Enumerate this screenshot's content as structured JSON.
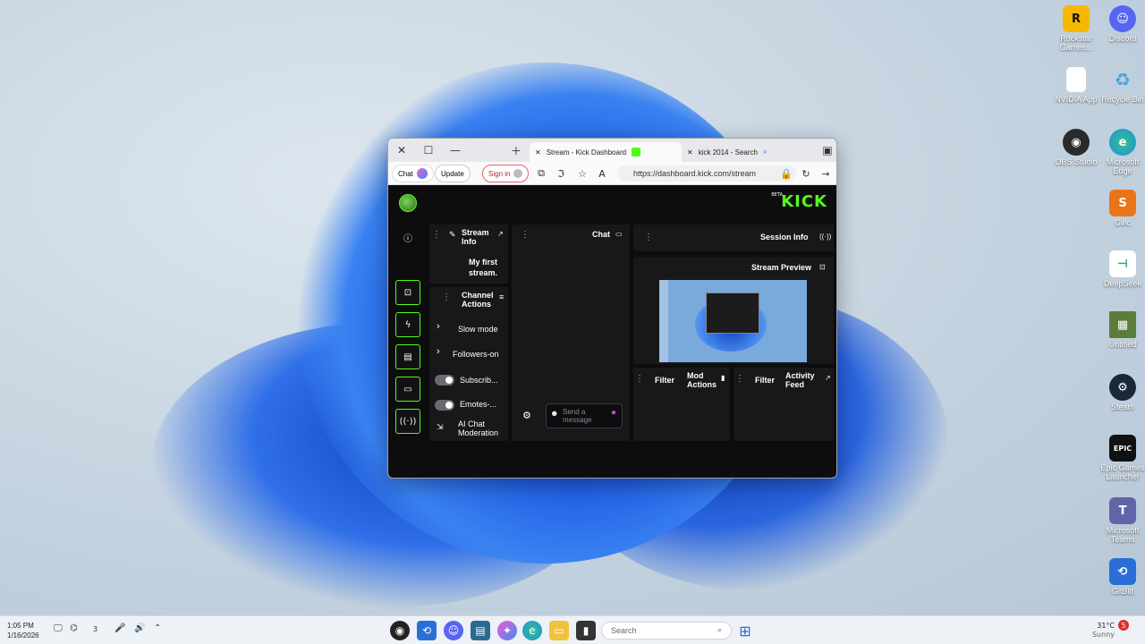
{
  "desktop": {
    "icons_right": [
      {
        "label": "Discord",
        "icon": "discord-icon",
        "color": "#5865f2"
      },
      {
        "label": "Rockstar Games...",
        "icon": "rockstar-icon",
        "color": "#f5b700"
      },
      {
        "label": "Recycle Bin",
        "icon": "recycle-bin-icon",
        "color": "#4aa3df"
      },
      {
        "label": "NVIDIA App",
        "icon": "file-icon",
        "color": "#ffffff"
      },
      {
        "label": "Microsoft Edge",
        "icon": "edge-icon",
        "color": "#1f8fd8"
      },
      {
        "label": "OBS Studio",
        "icon": "obs-icon",
        "color": "#2b2b2b"
      },
      {
        "label": "Gvlc",
        "icon": "app-icon",
        "color": "#e8751a"
      },
      {
        "label": "DeepSeek",
        "icon": "deepseek-icon",
        "color": "#ffffff"
      },
      {
        "label": "Untitled",
        "icon": "minecraft-icon",
        "color": "#5b7d3a"
      },
      {
        "label": "Steam",
        "icon": "steam-icon",
        "color": "#1b2838"
      },
      {
        "label": "Epic Games Launcher",
        "icon": "epic-games-icon",
        "color": "#111111"
      },
      {
        "label": "Microsoft Teams",
        "icon": "teams-icon",
        "color": "#6264a7"
      },
      {
        "label": "GitBlit",
        "icon": "gitblit-icon",
        "color": "#2a6fd6"
      }
    ]
  },
  "browser": {
    "tabs": [
      {
        "label": "Stream - Kick Dashboard",
        "icon": "kick-icon"
      },
      {
        "label": "kick 2014 - Search",
        "icon": "search-icon"
      }
    ],
    "url": "https://dashboard.kick.com/stream",
    "sign_in_label": "Sign in",
    "update_label": "Update",
    "chat_label": "Chat"
  },
  "kick": {
    "logo": "KICK",
    "beta": "BETA",
    "panels": {
      "session_info": "Session Info",
      "stream_preview": "Stream Preview",
      "chat": "Chat",
      "stream_info": "Stream Info",
      "stream_title": "My first stream.",
      "channel_actions": "Channel Actions",
      "activity_feed": "Activity Feed",
      "mod_actions": "Mod Actions",
      "filter": "Filter"
    },
    "channel_actions": [
      {
        "label": "Slow mode",
        "control": "chevron"
      },
      {
        "label": "Followers-on",
        "control": "chevron"
      },
      {
        "label": "Subscrib...",
        "control": "toggle"
      },
      {
        "label": "Emotes-...",
        "control": "toggle"
      },
      {
        "label": "AI Chat Moderation",
        "control": "external"
      }
    ],
    "chat_placeholder": "Send a message",
    "accent_color": "#53fc18"
  },
  "taskbar": {
    "search_placeholder": "Search",
    "time": "1:05 PM",
    "date": "1/16/2026",
    "weather": "31°C",
    "weather_sub": "Sunny",
    "badge": "3"
  }
}
